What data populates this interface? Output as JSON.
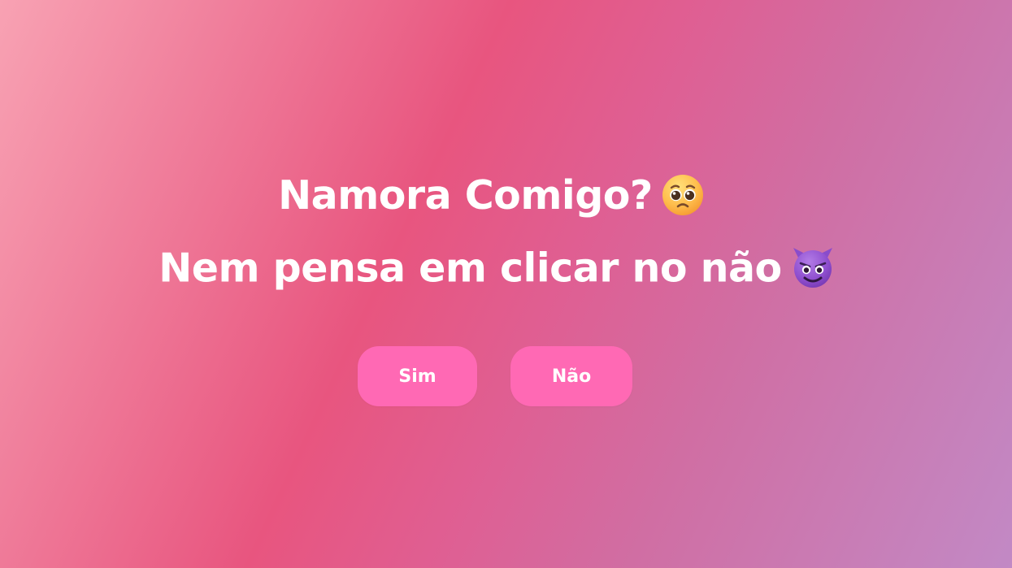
{
  "page": {
    "question": "Namora Comigo?",
    "subtitle": "Nem pensa em clicar no não"
  },
  "icons": {
    "question_emoji": "pleading-face-icon",
    "subtitle_emoji": "smiling-devil-icon"
  },
  "buttons": {
    "yes_label": "Sim",
    "no_label": "Não"
  },
  "colors": {
    "button": "#ff69b4",
    "text": "#ffffff",
    "background_start": "#f8a2b3",
    "background_mid": "#e8557f",
    "background_end": "#c289c5"
  }
}
